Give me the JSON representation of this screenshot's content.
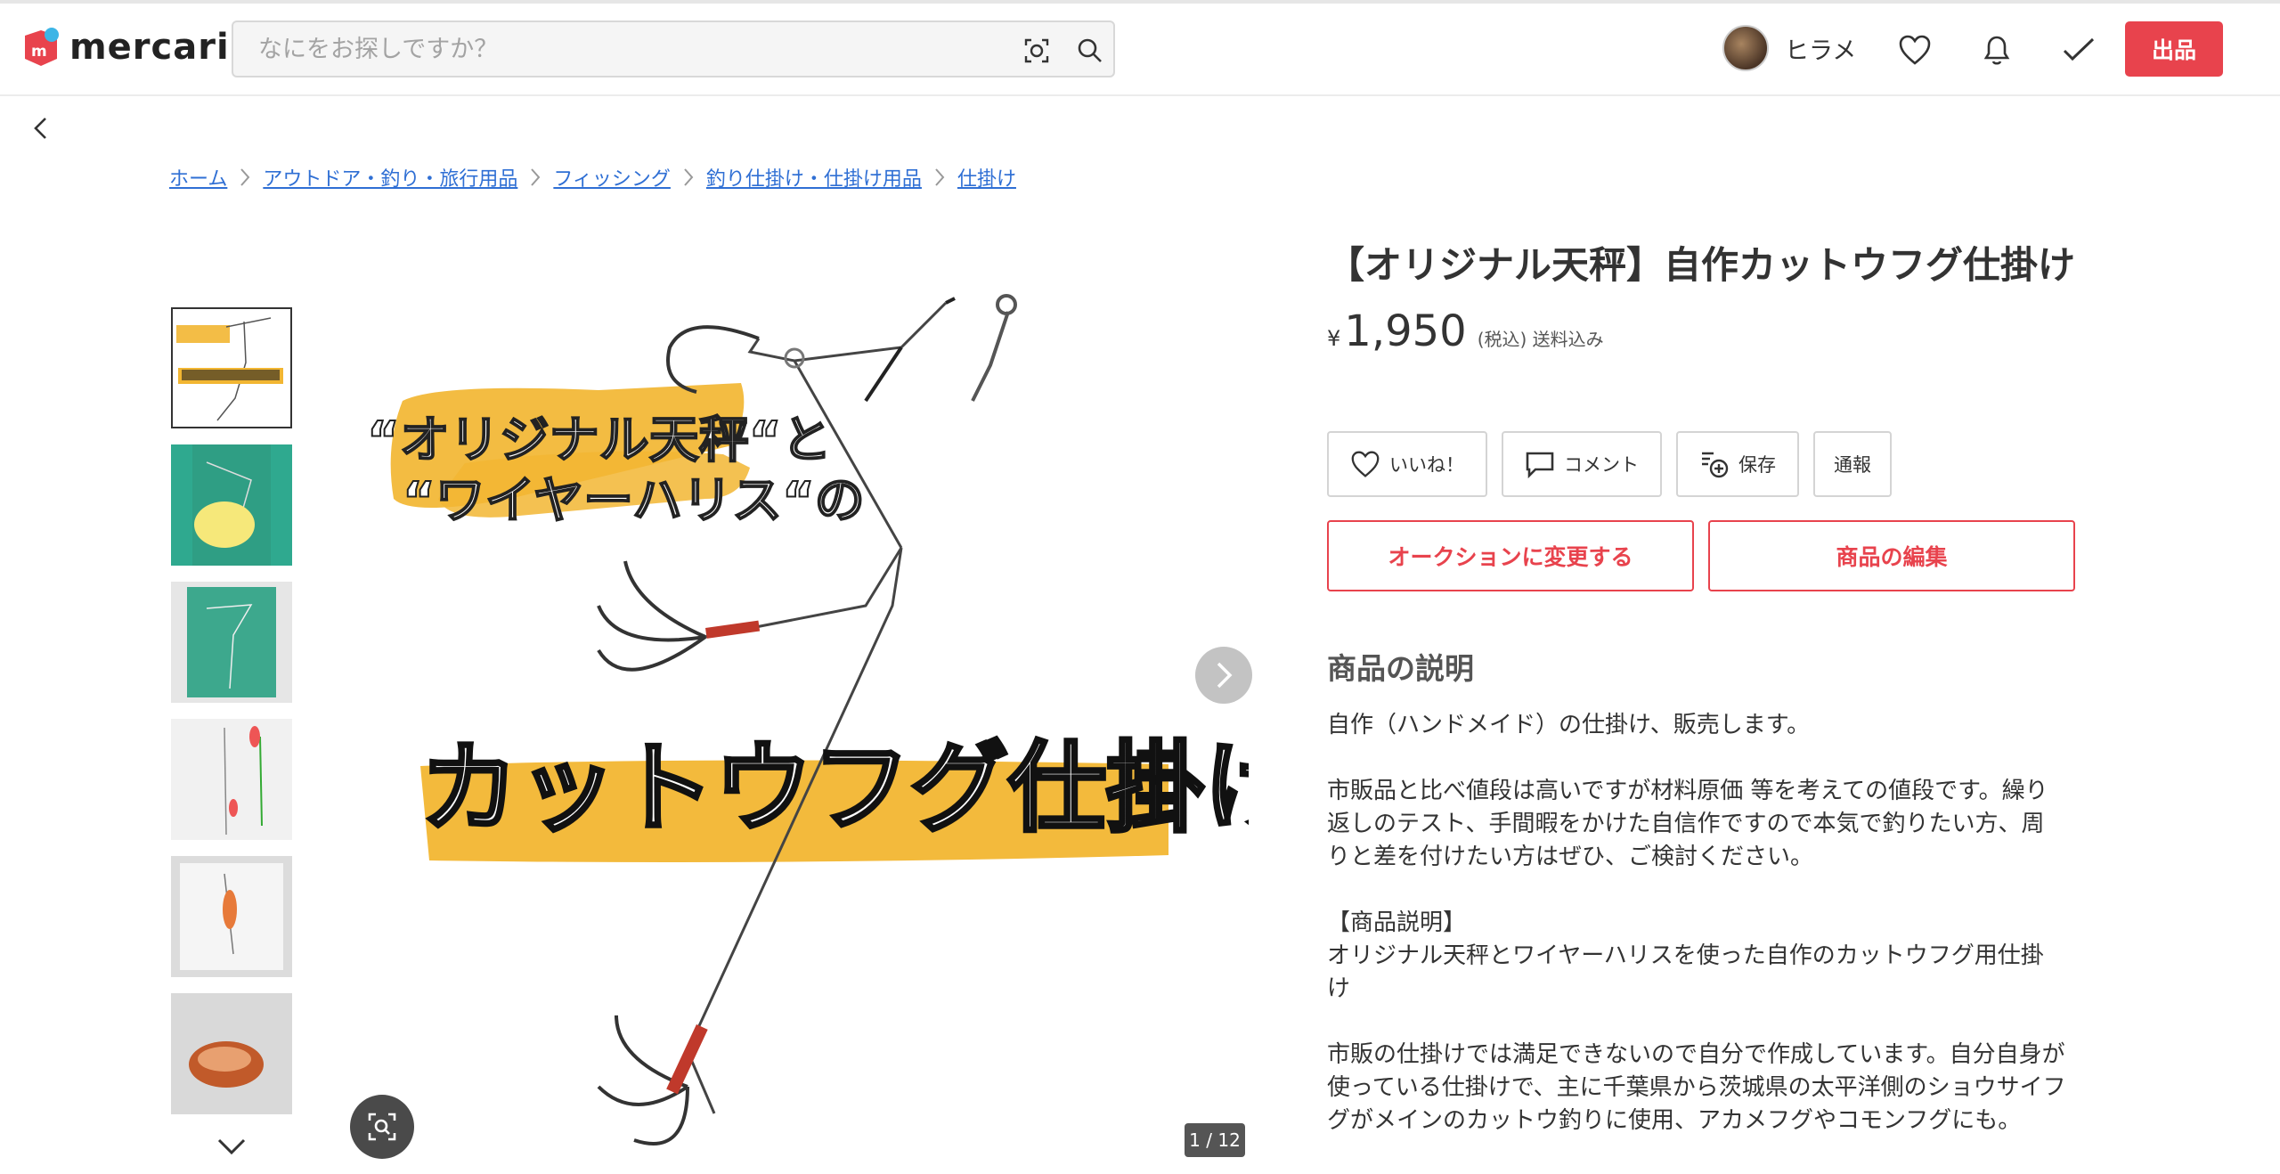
{
  "header": {
    "logo_text": "mercari",
    "search_placeholder": "なにをお探しですか？",
    "user_name": "ヒラメ",
    "sell_label": "出品"
  },
  "breadcrumb": [
    "ホーム",
    "アウトドア・釣り・旅行用品",
    "フィッシング",
    "釣り仕掛け・仕掛け用品",
    "仕掛け"
  ],
  "image": {
    "overlay_line1": "“オリジナル天秤“と",
    "overlay_line2": "“ワイヤーハリス“の",
    "overlay_big": "カットウフグ仕掛け",
    "counter": "1 / 12"
  },
  "product": {
    "title": "【オリジナル天秤】自作カットウフグ仕掛け",
    "currency": "¥",
    "price": "1,950",
    "tax_note": "(税込) 送料込み",
    "actions": {
      "like": "いいね！",
      "comment": "コメント",
      "save": "保存",
      "report": "通報"
    },
    "auction_btn": "オークションに変更する",
    "edit_btn": "商品の編集",
    "description_heading": "商品の説明",
    "description": [
      "自作（ハンドメイド）の仕掛け、販売します。",
      "市販品と比べ値段は高いですが材料原価 等を考えての値段です。繰り返しのテスト、手間暇をかけた自信作ですので本気で釣りたい方、周りと差を付けたい方はぜひ、ご検討ください。",
      "【商品説明】\nオリジナル天秤とワイヤーハリスを使った自作のカットウフグ用仕掛け",
      "市販の仕掛けでは満足できないので自分で作成しています。自分自身が使っている仕掛けで、主に千葉県から茨城県の太平洋側のショウサイフグがメインのカットウ釣りに使用、アカメフグやコモンフグにも。"
    ]
  },
  "colors": {
    "accent": "#e8434d",
    "link": "#2f6fd4",
    "highlight": "#f2b632"
  }
}
